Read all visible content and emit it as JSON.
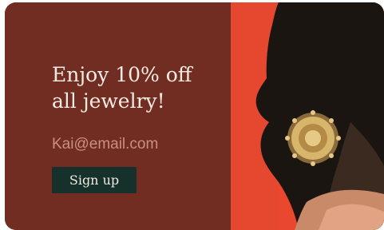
{
  "promo": {
    "headline_line1": "Enjoy 10% off",
    "headline_line2": "all jewelry!",
    "email_value": "Kai@email.com",
    "signup_label": "Sign up"
  },
  "image": {
    "subject": "portrait-profile-with-gold-earring"
  },
  "colors": {
    "panel": "#722d22",
    "headline": "#f6ece4",
    "input_text": "#c98f7f",
    "button_bg": "#16302c",
    "button_text": "#f1ebe2",
    "photo_bg": "#e9472e",
    "gold": "#c99f4a"
  }
}
